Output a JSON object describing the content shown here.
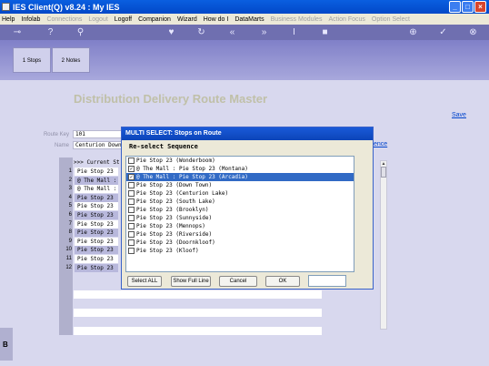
{
  "window": {
    "title": "IES Client(Q) v8.24 : My IES"
  },
  "menu": {
    "items": [
      {
        "label": "Help",
        "disabled": false
      },
      {
        "label": "Infolab",
        "disabled": false
      },
      {
        "label": "Connections",
        "disabled": true
      },
      {
        "label": "Logout",
        "disabled": true
      },
      {
        "label": "Logoff",
        "disabled": false
      },
      {
        "label": "Companion",
        "disabled": false
      },
      {
        "label": "Wizard",
        "disabled": false
      },
      {
        "label": "How do I",
        "disabled": false
      },
      {
        "label": "DataMarts",
        "disabled": false
      },
      {
        "label": "Business Modules",
        "disabled": true
      },
      {
        "label": "Action Focus",
        "disabled": true
      },
      {
        "label": "Option Select",
        "disabled": true
      }
    ]
  },
  "tabs": [
    {
      "label": "1 Stops"
    },
    {
      "label": "2 Notes"
    }
  ],
  "page": {
    "title": "Distribution Delivery Route Master",
    "save_label": "Save",
    "route_key_label": "Route Key",
    "route_key_value": "101",
    "name_label": "Name",
    "name_value": "Centurion Down",
    "sequence_link": "ence"
  },
  "grid": {
    "header": ">>> Current St",
    "rows": [
      {
        "num": "1",
        "text": "Pie Stop 23"
      },
      {
        "num": "2",
        "text": "@ The Mall :"
      },
      {
        "num": "3",
        "text": "@ The Mall :"
      },
      {
        "num": "4",
        "text": "Pie Stop 23"
      },
      {
        "num": "5",
        "text": "Pie Stop 23"
      },
      {
        "num": "6",
        "text": "Pie Stop 23"
      },
      {
        "num": "7",
        "text": "Pie Stop 23"
      },
      {
        "num": "8",
        "text": "Pie Stop 23"
      },
      {
        "num": "9",
        "text": "Pie Stop 23"
      },
      {
        "num": "10",
        "text": "Pie Stop 23"
      },
      {
        "num": "11",
        "text": "Pie Stop 23"
      },
      {
        "num": "12",
        "text": "Pie Stop 23"
      }
    ]
  },
  "dialog": {
    "title": "MULTI SELECT: Stops on Route",
    "subtitle": "Re-select Sequence",
    "items": [
      {
        "text": "Pie Stop 23 (Wonderboom)",
        "checked": false,
        "selected": false
      },
      {
        "text": "@ The Mall : Pie Stop 23 (Montana)",
        "checked": true,
        "selected": false
      },
      {
        "text": "@ The Mall : Pie Stop 23 (Arcadia)",
        "checked": true,
        "selected": true
      },
      {
        "text": "Pie Stop 23 (Down Town)",
        "checked": false,
        "selected": false
      },
      {
        "text": "Pie Stop 23 (Centurion Lake)",
        "checked": false,
        "selected": false
      },
      {
        "text": "Pie Stop 23 (South Lake)",
        "checked": false,
        "selected": false
      },
      {
        "text": "Pie Stop 23 (Brooklyn)",
        "checked": false,
        "selected": false
      },
      {
        "text": "Pie Stop 23 (Sunnyside)",
        "checked": false,
        "selected": false
      },
      {
        "text": "Pie Stop 23 (Mennops)",
        "checked": false,
        "selected": false
      },
      {
        "text": "Pie Stop 23 (Riverside)",
        "checked": false,
        "selected": false
      },
      {
        "text": "Pie Stop 23 (Doornkloof)",
        "checked": false,
        "selected": false
      },
      {
        "text": "Pie Stop 23 (Kloof)",
        "checked": false,
        "selected": false
      }
    ],
    "buttons": {
      "select_all": "Select ALL",
      "show_full_line": "Show Full Line",
      "cancel": "Cancel",
      "ok": "OK"
    }
  },
  "left_panel": {
    "label": "B"
  },
  "colors": {
    "titlebar": "#0a5fe0",
    "toolbar": "#6f6fb0",
    "selection": "#316ac5",
    "background": "#d8d8ee"
  }
}
